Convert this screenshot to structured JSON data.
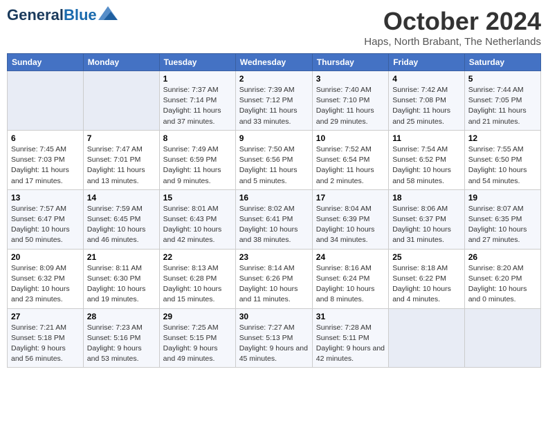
{
  "header": {
    "logo_line1": "General",
    "logo_line2": "Blue",
    "month_title": "October 2024",
    "location": "Haps, North Brabant, The Netherlands"
  },
  "days_of_week": [
    "Sunday",
    "Monday",
    "Tuesday",
    "Wednesday",
    "Thursday",
    "Friday",
    "Saturday"
  ],
  "weeks": [
    [
      {
        "day": "",
        "sunrise": "",
        "sunset": "",
        "daylight": ""
      },
      {
        "day": "",
        "sunrise": "",
        "sunset": "",
        "daylight": ""
      },
      {
        "day": "1",
        "sunrise": "Sunrise: 7:37 AM",
        "sunset": "Sunset: 7:14 PM",
        "daylight": "Daylight: 11 hours and 37 minutes."
      },
      {
        "day": "2",
        "sunrise": "Sunrise: 7:39 AM",
        "sunset": "Sunset: 7:12 PM",
        "daylight": "Daylight: 11 hours and 33 minutes."
      },
      {
        "day": "3",
        "sunrise": "Sunrise: 7:40 AM",
        "sunset": "Sunset: 7:10 PM",
        "daylight": "Daylight: 11 hours and 29 minutes."
      },
      {
        "day": "4",
        "sunrise": "Sunrise: 7:42 AM",
        "sunset": "Sunset: 7:08 PM",
        "daylight": "Daylight: 11 hours and 25 minutes."
      },
      {
        "day": "5",
        "sunrise": "Sunrise: 7:44 AM",
        "sunset": "Sunset: 7:05 PM",
        "daylight": "Daylight: 11 hours and 21 minutes."
      }
    ],
    [
      {
        "day": "6",
        "sunrise": "Sunrise: 7:45 AM",
        "sunset": "Sunset: 7:03 PM",
        "daylight": "Daylight: 11 hours and 17 minutes."
      },
      {
        "day": "7",
        "sunrise": "Sunrise: 7:47 AM",
        "sunset": "Sunset: 7:01 PM",
        "daylight": "Daylight: 11 hours and 13 minutes."
      },
      {
        "day": "8",
        "sunrise": "Sunrise: 7:49 AM",
        "sunset": "Sunset: 6:59 PM",
        "daylight": "Daylight: 11 hours and 9 minutes."
      },
      {
        "day": "9",
        "sunrise": "Sunrise: 7:50 AM",
        "sunset": "Sunset: 6:56 PM",
        "daylight": "Daylight: 11 hours and 5 minutes."
      },
      {
        "day": "10",
        "sunrise": "Sunrise: 7:52 AM",
        "sunset": "Sunset: 6:54 PM",
        "daylight": "Daylight: 11 hours and 2 minutes."
      },
      {
        "day": "11",
        "sunrise": "Sunrise: 7:54 AM",
        "sunset": "Sunset: 6:52 PM",
        "daylight": "Daylight: 10 hours and 58 minutes."
      },
      {
        "day": "12",
        "sunrise": "Sunrise: 7:55 AM",
        "sunset": "Sunset: 6:50 PM",
        "daylight": "Daylight: 10 hours and 54 minutes."
      }
    ],
    [
      {
        "day": "13",
        "sunrise": "Sunrise: 7:57 AM",
        "sunset": "Sunset: 6:47 PM",
        "daylight": "Daylight: 10 hours and 50 minutes."
      },
      {
        "day": "14",
        "sunrise": "Sunrise: 7:59 AM",
        "sunset": "Sunset: 6:45 PM",
        "daylight": "Daylight: 10 hours and 46 minutes."
      },
      {
        "day": "15",
        "sunrise": "Sunrise: 8:01 AM",
        "sunset": "Sunset: 6:43 PM",
        "daylight": "Daylight: 10 hours and 42 minutes."
      },
      {
        "day": "16",
        "sunrise": "Sunrise: 8:02 AM",
        "sunset": "Sunset: 6:41 PM",
        "daylight": "Daylight: 10 hours and 38 minutes."
      },
      {
        "day": "17",
        "sunrise": "Sunrise: 8:04 AM",
        "sunset": "Sunset: 6:39 PM",
        "daylight": "Daylight: 10 hours and 34 minutes."
      },
      {
        "day": "18",
        "sunrise": "Sunrise: 8:06 AM",
        "sunset": "Sunset: 6:37 PM",
        "daylight": "Daylight: 10 hours and 31 minutes."
      },
      {
        "day": "19",
        "sunrise": "Sunrise: 8:07 AM",
        "sunset": "Sunset: 6:35 PM",
        "daylight": "Daylight: 10 hours and 27 minutes."
      }
    ],
    [
      {
        "day": "20",
        "sunrise": "Sunrise: 8:09 AM",
        "sunset": "Sunset: 6:32 PM",
        "daylight": "Daylight: 10 hours and 23 minutes."
      },
      {
        "day": "21",
        "sunrise": "Sunrise: 8:11 AM",
        "sunset": "Sunset: 6:30 PM",
        "daylight": "Daylight: 10 hours and 19 minutes."
      },
      {
        "day": "22",
        "sunrise": "Sunrise: 8:13 AM",
        "sunset": "Sunset: 6:28 PM",
        "daylight": "Daylight: 10 hours and 15 minutes."
      },
      {
        "day": "23",
        "sunrise": "Sunrise: 8:14 AM",
        "sunset": "Sunset: 6:26 PM",
        "daylight": "Daylight: 10 hours and 11 minutes."
      },
      {
        "day": "24",
        "sunrise": "Sunrise: 8:16 AM",
        "sunset": "Sunset: 6:24 PM",
        "daylight": "Daylight: 10 hours and 8 minutes."
      },
      {
        "day": "25",
        "sunrise": "Sunrise: 8:18 AM",
        "sunset": "Sunset: 6:22 PM",
        "daylight": "Daylight: 10 hours and 4 minutes."
      },
      {
        "day": "26",
        "sunrise": "Sunrise: 8:20 AM",
        "sunset": "Sunset: 6:20 PM",
        "daylight": "Daylight: 10 hours and 0 minutes."
      }
    ],
    [
      {
        "day": "27",
        "sunrise": "Sunrise: 7:21 AM",
        "sunset": "Sunset: 5:18 PM",
        "daylight": "Daylight: 9 hours and 56 minutes."
      },
      {
        "day": "28",
        "sunrise": "Sunrise: 7:23 AM",
        "sunset": "Sunset: 5:16 PM",
        "daylight": "Daylight: 9 hours and 53 minutes."
      },
      {
        "day": "29",
        "sunrise": "Sunrise: 7:25 AM",
        "sunset": "Sunset: 5:15 PM",
        "daylight": "Daylight: 9 hours and 49 minutes."
      },
      {
        "day": "30",
        "sunrise": "Sunrise: 7:27 AM",
        "sunset": "Sunset: 5:13 PM",
        "daylight": "Daylight: 9 hours and 45 minutes."
      },
      {
        "day": "31",
        "sunrise": "Sunrise: 7:28 AM",
        "sunset": "Sunset: 5:11 PM",
        "daylight": "Daylight: 9 hours and 42 minutes."
      },
      {
        "day": "",
        "sunrise": "",
        "sunset": "",
        "daylight": ""
      },
      {
        "day": "",
        "sunrise": "",
        "sunset": "",
        "daylight": ""
      }
    ]
  ]
}
